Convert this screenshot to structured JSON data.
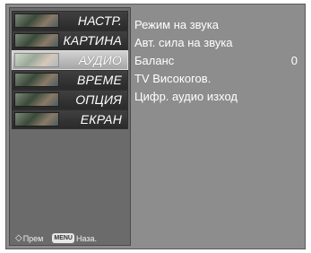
{
  "menu": {
    "items": [
      {
        "label": "НАСТР.",
        "selected": false
      },
      {
        "label": "КАРТИНА",
        "selected": false
      },
      {
        "label": "АУДИО",
        "selected": true
      },
      {
        "label": "ВРЕМЕ",
        "selected": false
      },
      {
        "label": "ОПЦИЯ",
        "selected": false
      },
      {
        "label": "ЕКРАН",
        "selected": false
      }
    ]
  },
  "submenu": {
    "items": [
      {
        "label": "Режим на звука",
        "value": ""
      },
      {
        "label": "Авт. сила на звука",
        "value": ""
      },
      {
        "label": "Баланс",
        "value": "0"
      },
      {
        "label": "TV Високогов.",
        "value": ""
      },
      {
        "label": "Цифр. аудио изход",
        "value": ""
      }
    ]
  },
  "footer": {
    "nav_icon": "◇",
    "move_label": "Прем",
    "menu_key": "MENU",
    "back_label": "Наза."
  },
  "colors": {
    "screen_bg": "#8d8d8d",
    "panel_bg": "#6b6b6b",
    "selected_item": "#bdbdbd",
    "text": "#ffffff"
  }
}
